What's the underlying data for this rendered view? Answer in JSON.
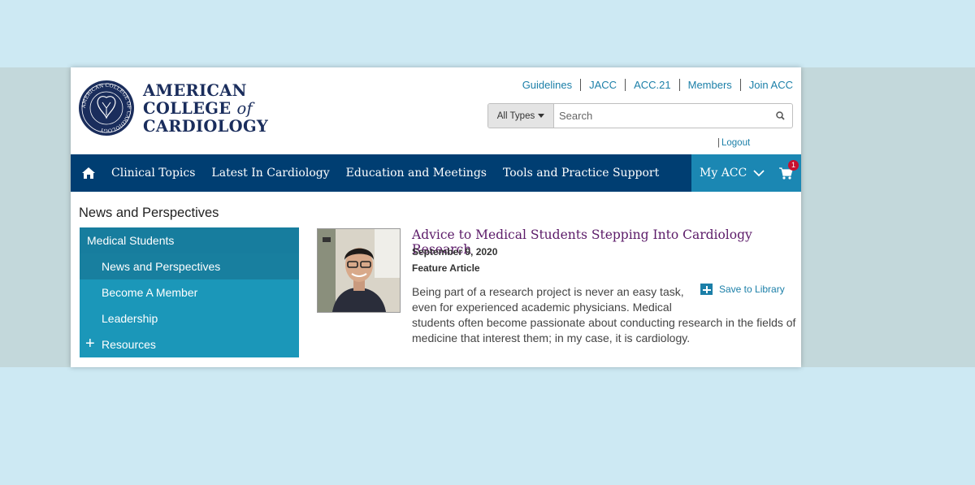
{
  "logo": {
    "line1": "AMERICAN",
    "line2": "COLLEGE",
    "of": "of",
    "line3": "CARDIOLOGY",
    "seal_text": "AMERICAN COLLEGE OF CARDIOLOGY"
  },
  "toplinks": [
    "Guidelines",
    "JACC",
    "ACC.21",
    "Members",
    "Join ACC"
  ],
  "search": {
    "type_label": "All Types",
    "placeholder": "Search"
  },
  "account": {
    "logout": "Logout"
  },
  "nav": {
    "items": [
      "Clinical Topics",
      "Latest In Cardiology",
      "Education and Meetings",
      "Tools and Practice Support"
    ],
    "my_acc": "My ACC",
    "cart_count": "1"
  },
  "section_title": "News and Perspectives",
  "sidebar": {
    "head": "Medical Students",
    "items": [
      {
        "label": "News and Perspectives"
      },
      {
        "label": "Become A Member"
      },
      {
        "label": "Leadership"
      },
      {
        "label": "Resources"
      }
    ]
  },
  "article": {
    "title": "Advice to Medical Students Stepping Into Cardiology Research",
    "date": "September 9, 2020",
    "type": "Feature Article",
    "save_label": "Save to Library",
    "body_1": "Being part of a research project is never an easy task, even for experienced academic physicians. Medical",
    "body_2": "students often become passionate about conducting research in the fields of medicine that interest them; in my case, it is cardiology."
  },
  "colors": {
    "nav": "#003e72",
    "my_acc": "#1b87b3",
    "sidebar": "#1b97b9",
    "link": "#1b7fa8",
    "title": "#5b1a68",
    "badge": "#c8102e"
  }
}
